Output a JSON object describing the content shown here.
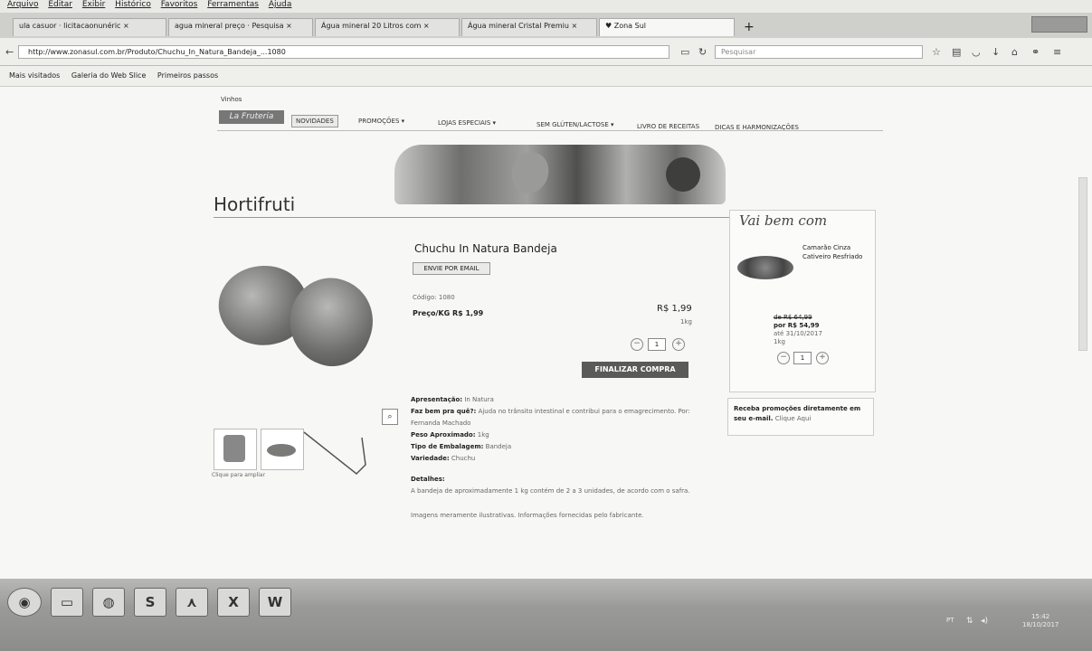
{
  "menubar": [
    "Arquivo",
    "Editar",
    "Exibir",
    "Histórico",
    "Favoritos",
    "Ferramentas",
    "Ajuda"
  ],
  "tabs": [
    {
      "label": "ula casuor · licitacaonunéric ×"
    },
    {
      "label": "agua mineral preço · Pesquisa ×"
    },
    {
      "label": "Água mineral 20 Litros com ×"
    },
    {
      "label": "Água mineral Cristal Premiu ×"
    },
    {
      "label": "Zona Sul"
    }
  ],
  "new_tab": "+",
  "url": "http://www.zonasul.com.br/Produto/Chuchu_In_Natura_Bandeja_...1080",
  "search_placeholder": "Pesquisar",
  "bookmarks": [
    "Mais visitados",
    "Galeria do Web Slice",
    "Primeiros passos"
  ],
  "site": {
    "top_link": "Vinhos",
    "logo_text": "La Fruteria",
    "nav": [
      "NOVIDADES",
      "PROMOÇÕES ▾",
      "LOJAS ESPECIAIS ▾",
      "SEM GLÚTEN/LACTOSE ▾",
      "LIVRO DE RECEITAS",
      "DICAS E HARMONIZAÇÕES"
    ],
    "category_title": "Hortifruti",
    "product": {
      "name": "Chuchu In Natura Bandeja",
      "email_button": "ENVIE POR EMAIL",
      "code": "Código: 1080",
      "price_per_kg": "Preço/KG R$ 1,99",
      "price": "R$ 1,99",
      "unit": "1kg",
      "qty": "1",
      "buy_button": "FINALIZAR COMPRA",
      "thumb_caption": "Clique para ampliar",
      "details": [
        {
          "label": "Apresentação:",
          "value": "In Natura"
        },
        {
          "label": "Faz bem pra quê?:",
          "value": "Ajuda no trânsito intestinal e contribui para o emagrecimento. Por: Fernanda Machado"
        },
        {
          "label": "Peso Aproximado:",
          "value": "1kg"
        },
        {
          "label": "Tipo de Embalagem:",
          "value": "Bandeja"
        },
        {
          "label": "Variedade:",
          "value": "Chuchu"
        }
      ],
      "detalhes_label": "Detalhes:",
      "detalhes_text": "A bandeja de aproximadamente 1 kg contém de 2 a 3 unidades, de acordo com o safra.",
      "disclaimer": "Imagens meramente ilustrativas. Informações fornecidas pelo fabricante."
    },
    "sidebar": {
      "title": "Vai bem com",
      "item_name": "Camarão Cinza Cativeiro Resfriado",
      "old_price": "de R$ 64,99",
      "new_price": "por R$ 54,99",
      "valid": "até 31/10/2017",
      "unit": "1kg",
      "qty": "1",
      "newsletter_text": "Receba promoções diretamente em seu e-mail.",
      "newsletter_link": "Clique Aqui"
    }
  },
  "tray": {
    "lang": "PT",
    "time": "15:42",
    "date": "18/10/2017"
  },
  "taskbar_icons": [
    "start",
    "folder",
    "firefox",
    "S",
    "pdf",
    "excel",
    "W"
  ]
}
